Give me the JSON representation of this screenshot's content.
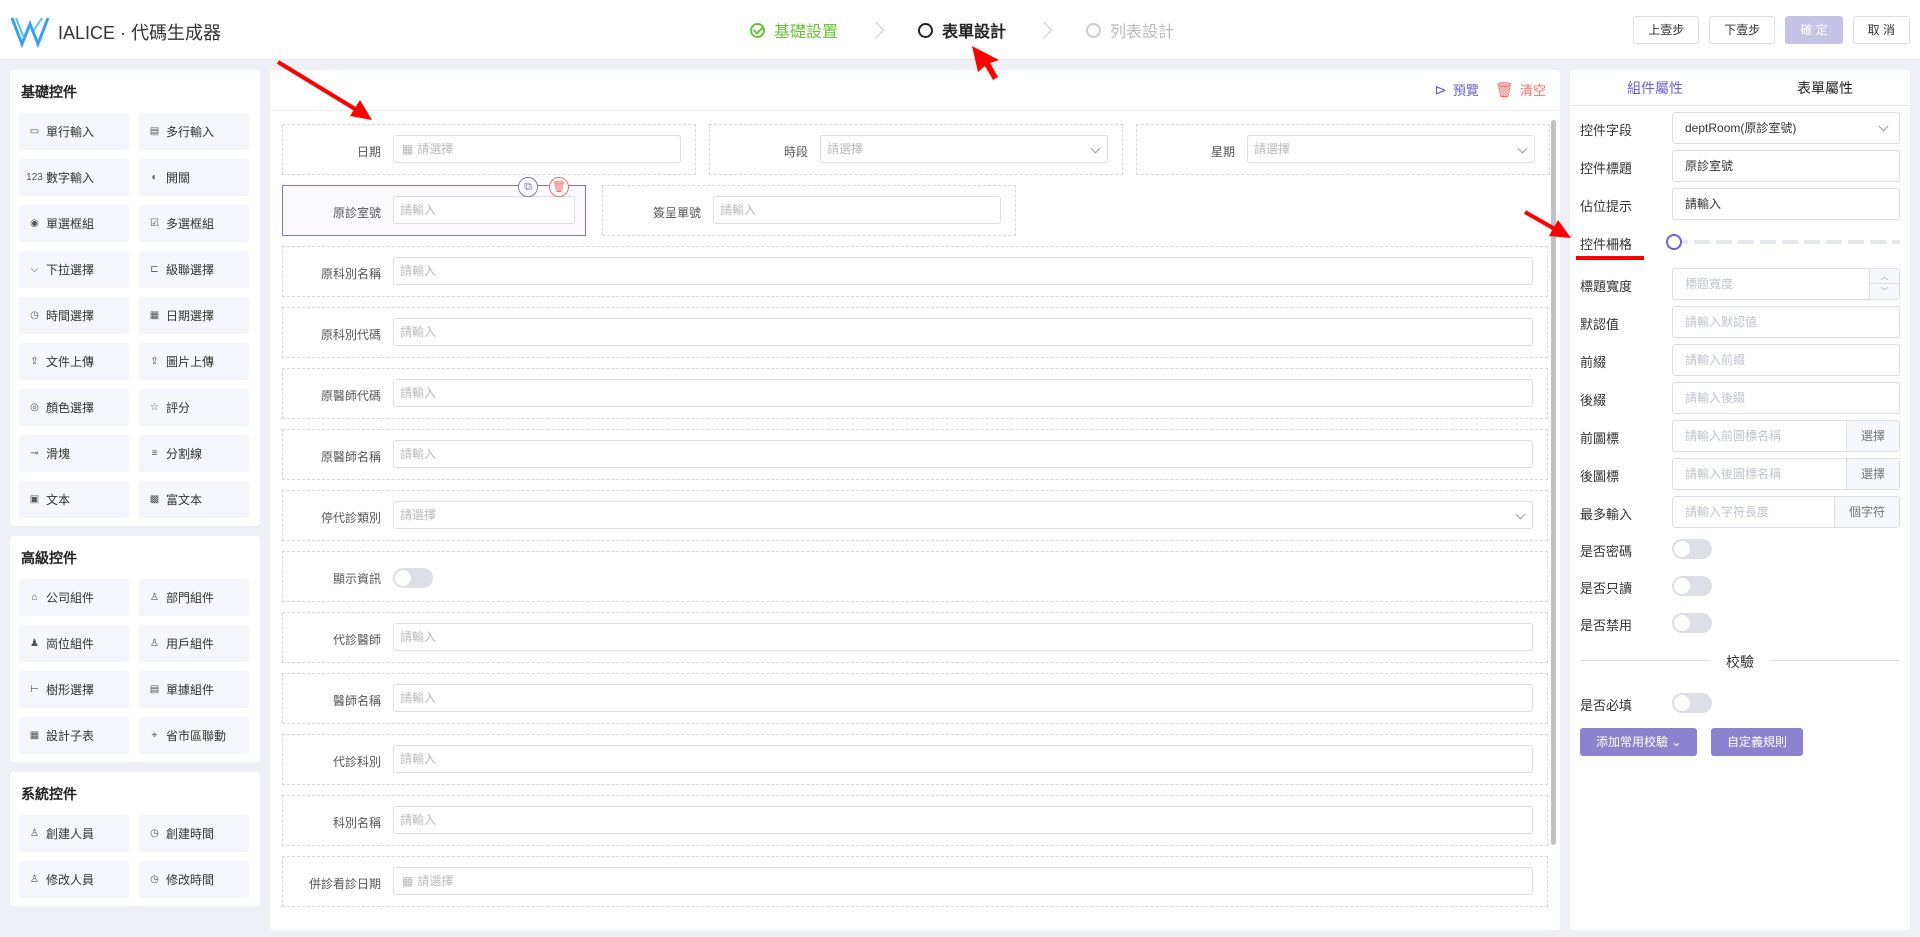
{
  "app": {
    "title": "IALICE · 代碼生成器"
  },
  "steps": [
    {
      "label": "基礎設置",
      "state": "done"
    },
    {
      "label": "表單設計",
      "state": "active"
    },
    {
      "label": "列表設計",
      "state": "pending"
    }
  ],
  "top_actions": {
    "prev": "上壹步",
    "next": "下壹步",
    "confirm": "確 定",
    "cancel": "取 消"
  },
  "left": {
    "basic": {
      "title": "基礎控件",
      "items": [
        {
          "label": "單行輸入",
          "icon": "single-line-icon"
        },
        {
          "label": "多行輸入",
          "icon": "multi-line-icon"
        },
        {
          "label": "數字輸入",
          "icon": "number-icon"
        },
        {
          "label": "開關",
          "icon": "switch-icon"
        },
        {
          "label": "單選框組",
          "icon": "radio-icon"
        },
        {
          "label": "多選框組",
          "icon": "checkbox-icon"
        },
        {
          "label": "下拉選擇",
          "icon": "dropdown-icon"
        },
        {
          "label": "級聯選擇",
          "icon": "cascader-icon"
        },
        {
          "label": "時間選擇",
          "icon": "clock-icon"
        },
        {
          "label": "日期選擇",
          "icon": "calendar-icon"
        },
        {
          "label": "文件上傳",
          "icon": "upload-icon"
        },
        {
          "label": "圖片上傳",
          "icon": "image-upload-icon"
        },
        {
          "label": "顏色選擇",
          "icon": "palette-icon"
        },
        {
          "label": "評分",
          "icon": "star-icon"
        },
        {
          "label": "滑塊",
          "icon": "slider-icon"
        },
        {
          "label": "分割線",
          "icon": "divider-icon"
        },
        {
          "label": "文本",
          "icon": "text-icon"
        },
        {
          "label": "富文本",
          "icon": "rich-text-icon"
        }
      ]
    },
    "advanced": {
      "title": "高級控件",
      "items": [
        {
          "label": "公司組件",
          "icon": "company-icon"
        },
        {
          "label": "部門組件",
          "icon": "department-icon"
        },
        {
          "label": "崗位組件",
          "icon": "position-icon"
        },
        {
          "label": "用戶組件",
          "icon": "user-icon"
        },
        {
          "label": "樹形選擇",
          "icon": "tree-icon"
        },
        {
          "label": "單據組件",
          "icon": "document-icon"
        },
        {
          "label": "設計子表",
          "icon": "table-icon"
        },
        {
          "label": "省市區聯動",
          "icon": "location-icon"
        }
      ]
    },
    "system": {
      "title": "系統控件",
      "items": [
        {
          "label": "創建人員",
          "icon": "user-add-icon"
        },
        {
          "label": "創建時間",
          "icon": "clock-icon"
        },
        {
          "label": "修改人員",
          "icon": "user-edit-icon"
        },
        {
          "label": "修改時間",
          "icon": "clock-icon"
        }
      ]
    }
  },
  "center": {
    "preview": "預覽",
    "clear": "清空",
    "fields": {
      "date": {
        "label": "日期",
        "placeholder": "請選擇"
      },
      "period": {
        "label": "時段",
        "placeholder": "請選擇"
      },
      "weekday": {
        "label": "星期",
        "placeholder": "請選擇"
      },
      "orig_room": {
        "label": "原診室號",
        "placeholder": "請輸入"
      },
      "sign_no": {
        "label": "簽呈單號",
        "placeholder": "請輸入"
      },
      "orig_dept_name": {
        "label": "原科別名稱",
        "placeholder": "請輸入"
      },
      "orig_dept_code": {
        "label": "原科別代碼",
        "placeholder": "請輸入"
      },
      "orig_doc_code": {
        "label": "原醫師代碼",
        "placeholder": "請輸入"
      },
      "orig_doc_name": {
        "label": "原醫師名稱",
        "placeholder": "請輸入"
      },
      "stop_type": {
        "label": "停代診類別",
        "placeholder": "請選擇"
      },
      "show_info": {
        "label": "顯示資訊"
      },
      "sub_doc": {
        "label": "代診醫師",
        "placeholder": "請輸入"
      },
      "doc_name": {
        "label": "醫師名稱",
        "placeholder": "請輸入"
      },
      "sub_dept": {
        "label": "代診科別",
        "placeholder": "請輸入"
      },
      "dept_name": {
        "label": "科別名稱",
        "placeholder": "請輸入"
      },
      "merge_date": {
        "label": "併診看診日期",
        "placeholder": "請選擇"
      }
    }
  },
  "right": {
    "tabs": [
      "組件屬性",
      "表單屬性"
    ],
    "props": {
      "field": {
        "label": "控件字段",
        "value": "deptRoom(原診室號)"
      },
      "title": {
        "label": "控件標題",
        "value": "原診室號"
      },
      "placeholder": {
        "label": "佔位提示",
        "value": "請輸入"
      },
      "grid": {
        "label": "控件柵格",
        "level": 0
      },
      "label_width": {
        "label": "標題寬度",
        "placeholder": "標題寬度"
      },
      "default": {
        "label": "默認值",
        "placeholder": "請輸入默認值"
      },
      "prefix": {
        "label": "前綴",
        "placeholder": "請輸入前綴"
      },
      "suffix": {
        "label": "後綴",
        "placeholder": "請輸入後綴"
      },
      "prefix_icon": {
        "label": "前圖標",
        "placeholder": "請輸入前圖標名稱",
        "btn": "選擇"
      },
      "suffix_icon": {
        "label": "後圖標",
        "placeholder": "請輸入後圖標名稱",
        "btn": "選擇"
      },
      "maxlen": {
        "label": "最多輸入",
        "placeholder": "請輸入字符長度",
        "unit": "個字符"
      },
      "password": {
        "label": "是否密碼"
      },
      "readonly": {
        "label": "是否只讀"
      },
      "disabled": {
        "label": "是否禁用"
      },
      "validate_title": "校驗",
      "required": {
        "label": "是否必填"
      },
      "add_rule": "添加常用校驗",
      "custom_rule": "自定義規則"
    }
  },
  "colors": {
    "accent": "#6b62c9",
    "success": "#67c23a",
    "danger": "#f56c6c",
    "annotation": "#ff0000"
  }
}
